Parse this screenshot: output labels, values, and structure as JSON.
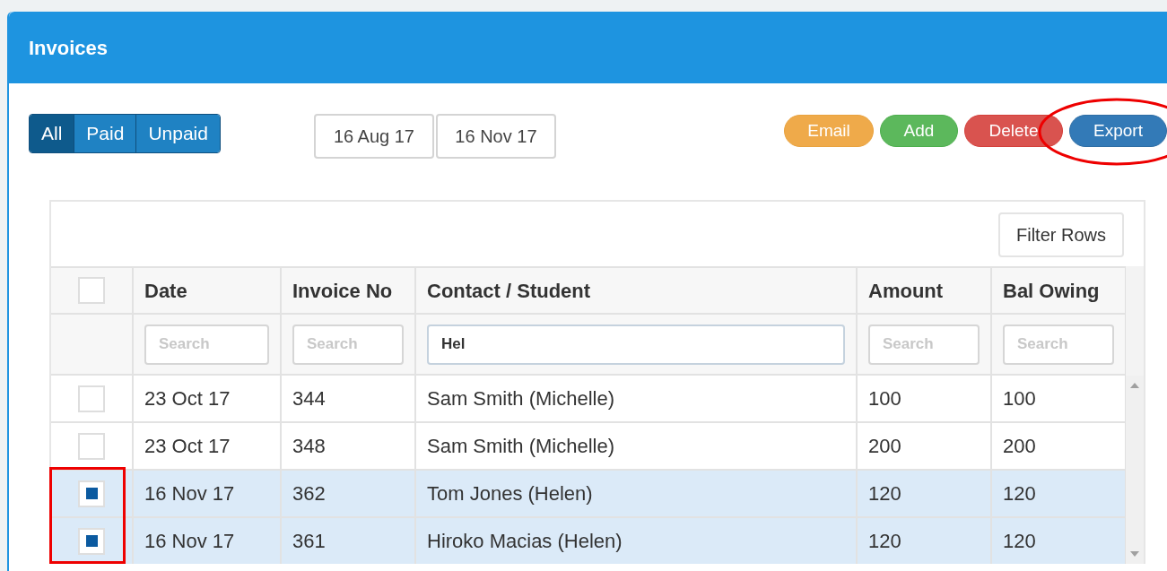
{
  "panel": {
    "title": "Invoices"
  },
  "status_filters": [
    {
      "label": "All",
      "selected": true
    },
    {
      "label": "Paid",
      "selected": false
    },
    {
      "label": "Unpaid",
      "selected": false
    }
  ],
  "date_range": [
    "16 Aug 17",
    "16 Nov 17"
  ],
  "actions": [
    {
      "label": "Email",
      "kind": "email"
    },
    {
      "label": "Add",
      "kind": "add"
    },
    {
      "label": "Delete",
      "kind": "delete"
    },
    {
      "label": "Export",
      "kind": "export"
    }
  ],
  "table": {
    "filter_button": "Filter Rows",
    "select_all_checked": false,
    "columns": [
      "Date",
      "Invoice No",
      "Contact / Student",
      "Amount",
      "Bal Owing"
    ],
    "column_filters": [
      {
        "placeholder": "Search"
      },
      {
        "placeholder": "Search"
      },
      {
        "value": "Hel"
      },
      {
        "placeholder": "Search"
      },
      {
        "placeholder": "Search"
      }
    ],
    "rows": [
      {
        "checked": false,
        "selected": false,
        "cells": [
          "23 Oct 17",
          "344",
          "Sam Smith (Michelle)",
          "100",
          "100"
        ]
      },
      {
        "checked": false,
        "selected": false,
        "cells": [
          "23 Oct 17",
          "348",
          "Sam Smith (Michelle)",
          "200",
          "200"
        ]
      },
      {
        "checked": true,
        "selected": true,
        "cells": [
          "16 Nov 17",
          "362",
          "Tom Jones (Helen)",
          "120",
          "120"
        ]
      },
      {
        "checked": true,
        "selected": true,
        "cells": [
          "16 Nov 17",
          "361",
          "Hiroko Macias (Helen)",
          "120",
          "120"
        ]
      }
    ]
  }
}
